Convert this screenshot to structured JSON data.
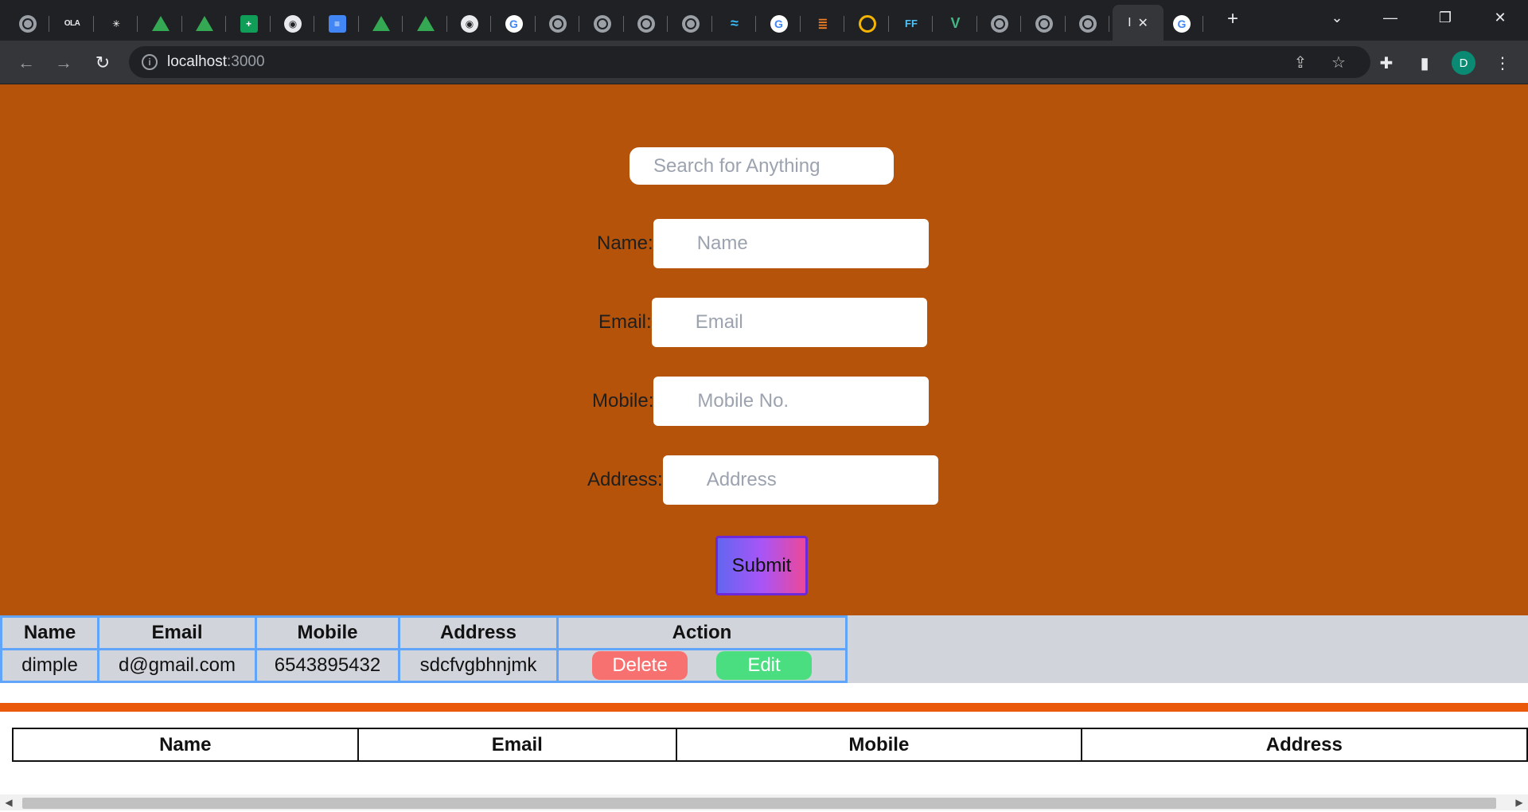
{
  "browser": {
    "tabs": [
      {
        "icon": "globe-icon"
      },
      {
        "icon": "ola-icon",
        "glyph": "OLA"
      },
      {
        "icon": "slack-icon"
      },
      {
        "icon": "google-drive-icon"
      },
      {
        "icon": "google-drive-icon"
      },
      {
        "icon": "google-sheets-icon"
      },
      {
        "icon": "github-icon"
      },
      {
        "icon": "google-docs-icon"
      },
      {
        "icon": "google-drive-icon"
      },
      {
        "icon": "google-drive-icon"
      },
      {
        "icon": "github-icon"
      },
      {
        "icon": "google-icon"
      },
      {
        "icon": "globe-icon"
      },
      {
        "icon": "globe-icon"
      },
      {
        "icon": "globe-icon"
      },
      {
        "icon": "globe-icon"
      },
      {
        "icon": "tailwind-icon"
      },
      {
        "icon": "google-icon"
      },
      {
        "icon": "stackoverflow-icon"
      },
      {
        "icon": "ring-icon"
      },
      {
        "icon": "ff-icon"
      },
      {
        "icon": "vue-icon"
      },
      {
        "icon": "globe-icon"
      },
      {
        "icon": "globe-icon"
      },
      {
        "icon": "globe-icon"
      }
    ],
    "active_tab": {
      "title": "I",
      "close_glyph": "✕"
    },
    "after_active_tab": {
      "icon": "google-icon"
    },
    "new_tab_glyph": "+",
    "url_host": "localhost",
    "url_port": ":3000",
    "profile_initial": "D",
    "colors": {
      "frame": "#202124",
      "toolbar": "#35363a",
      "avatar": "#0b8a73"
    }
  },
  "form": {
    "search_placeholder": "Search for Anything",
    "fields": [
      {
        "label": "Name:",
        "placeholder": "Name"
      },
      {
        "label": "Email:",
        "placeholder": "Email"
      },
      {
        "label": "Mobile:",
        "placeholder": "Mobile No."
      },
      {
        "label": "Address:",
        "placeholder": "Address"
      }
    ],
    "submit_label": "Submit",
    "colors": {
      "background": "#b45309",
      "submit_gradient": [
        "#6366f1",
        "#a855f7",
        "#ec4899"
      ]
    }
  },
  "records_table": {
    "headers": [
      "Name",
      "Email",
      "Mobile",
      "Address",
      "Action"
    ],
    "rows": [
      {
        "name": "dimple",
        "email": "d@gmail.com",
        "mobile": "6543895432",
        "address": "sdcfvgbhnjmk"
      }
    ],
    "delete_label": "Delete",
    "edit_label": "Edit",
    "colors": {
      "border": "#60a5fa",
      "background": "#d1d5db",
      "delete": "#f87171",
      "edit": "#4ade80"
    }
  },
  "lower_table": {
    "headers": [
      "Name",
      "Email",
      "Mobile",
      "Address"
    ]
  }
}
